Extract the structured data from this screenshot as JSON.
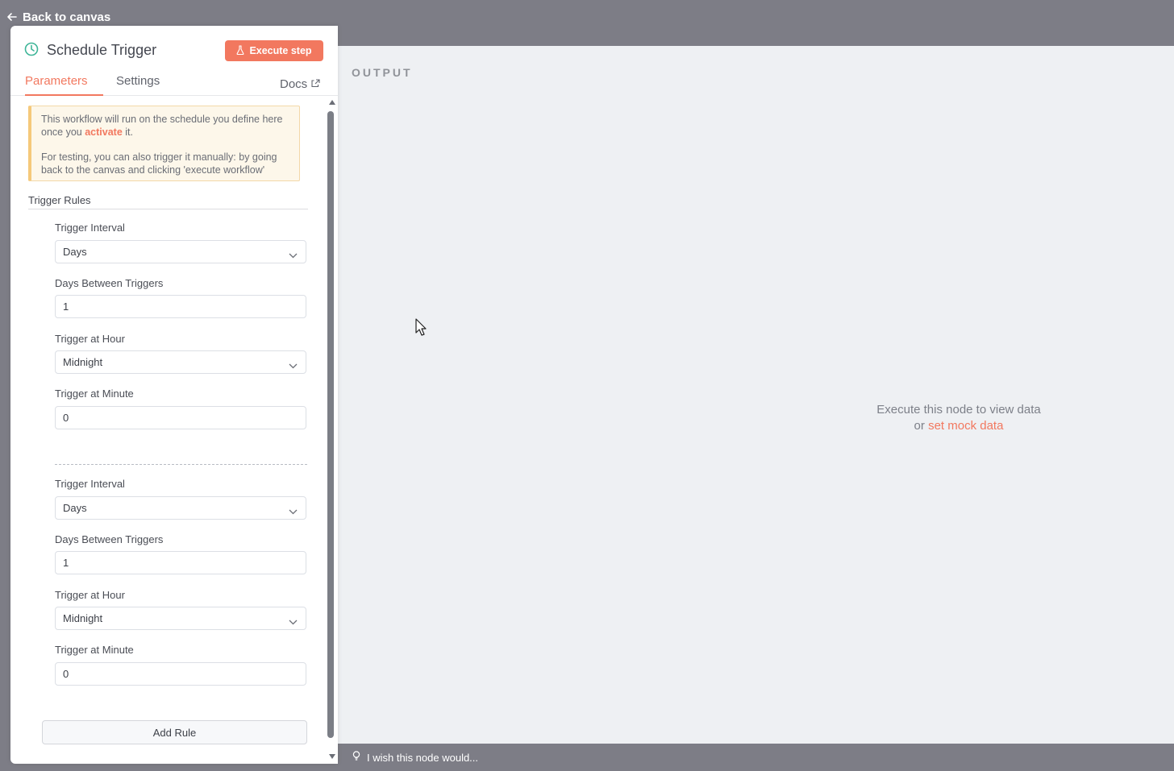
{
  "topbar": {
    "back_label": "Back to canvas"
  },
  "node": {
    "title": "Schedule Trigger",
    "execute_label": "Execute step"
  },
  "tabs": {
    "parameters": "Parameters",
    "settings": "Settings",
    "docs": "Docs"
  },
  "notice": {
    "line1_prefix": "This workflow will run on the schedule you define here once you ",
    "activate_link": "activate",
    "line1_suffix": " it.",
    "line2": "For testing, you can also trigger it manually: by going back to the canvas and clicking 'execute workflow'"
  },
  "trigger_rules": {
    "label": "Trigger Rules",
    "rules": [
      {
        "interval_label": "Trigger Interval",
        "interval_value": "Days",
        "days_label": "Days Between Triggers",
        "days_value": "1",
        "hour_label": "Trigger at Hour",
        "hour_value": "Midnight",
        "minute_label": "Trigger at Minute",
        "minute_value": "0"
      },
      {
        "interval_label": "Trigger Interval",
        "interval_value": "Days",
        "days_label": "Days Between Triggers",
        "days_value": "1",
        "hour_label": "Trigger at Hour",
        "hour_value": "Midnight",
        "minute_label": "Trigger at Minute",
        "minute_value": "0"
      }
    ],
    "add_rule_label": "Add Rule"
  },
  "output": {
    "title": "OUTPUT",
    "empty_line1": "Execute this node to view data",
    "empty_or": "or ",
    "empty_link": "set mock data"
  },
  "feedback": {
    "label": "I wish this node would..."
  },
  "icons": {
    "back": "arrow-left-icon",
    "node": "clock-icon",
    "execute": "flask-icon",
    "docs": "external-link-icon",
    "select": "chevron-down-icon",
    "feedback": "lightbulb-icon",
    "cursor": "mouse-pointer-icon"
  },
  "colors": {
    "accent": "#f2785f",
    "node_icon": "#3fb598",
    "notice_bg": "#fdf7ea",
    "overlay": "#7d7d86",
    "output_bg": "#eef0f3"
  }
}
